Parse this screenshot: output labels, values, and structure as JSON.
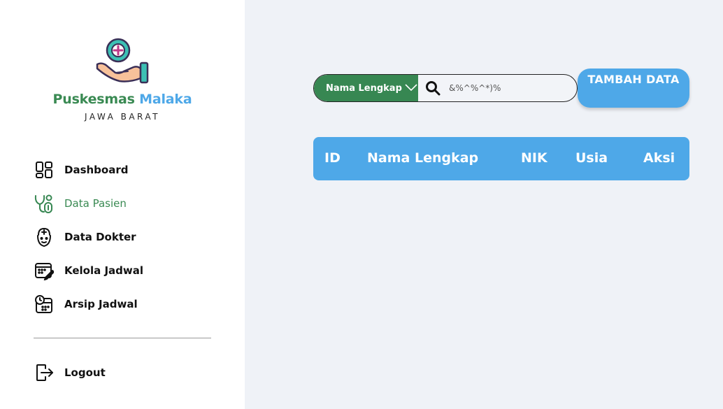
{
  "brand": {
    "name_part1": "Puskesmas",
    "name_part2": "Malaka",
    "region": "JAWA BARAT"
  },
  "sidebar": {
    "items": [
      {
        "label": "Dashboard",
        "icon": "dashboard-icon",
        "active": false
      },
      {
        "label": "Data Pasien",
        "icon": "stethoscope-icon",
        "active": true
      },
      {
        "label": "Data Dokter",
        "icon": "doctor-icon",
        "active": false
      },
      {
        "label": "Kelola Jadwal",
        "icon": "calendar-edit-icon",
        "active": false
      },
      {
        "label": "Arsip Jadwal",
        "icon": "calendar-clock-icon",
        "active": false
      }
    ],
    "logout_label": "Logout"
  },
  "search": {
    "filter_label": "Nama Lengkap",
    "value": "&%^%^*)%"
  },
  "add_button_label": "TAMBAH DATA",
  "table": {
    "columns": [
      "ID",
      "Nama Lengkap",
      "NIK",
      "Usia",
      "Aksi"
    ]
  },
  "colors": {
    "primary_green": "#378752",
    "primary_blue": "#4ea8e8",
    "background": "#eff2f7"
  }
}
